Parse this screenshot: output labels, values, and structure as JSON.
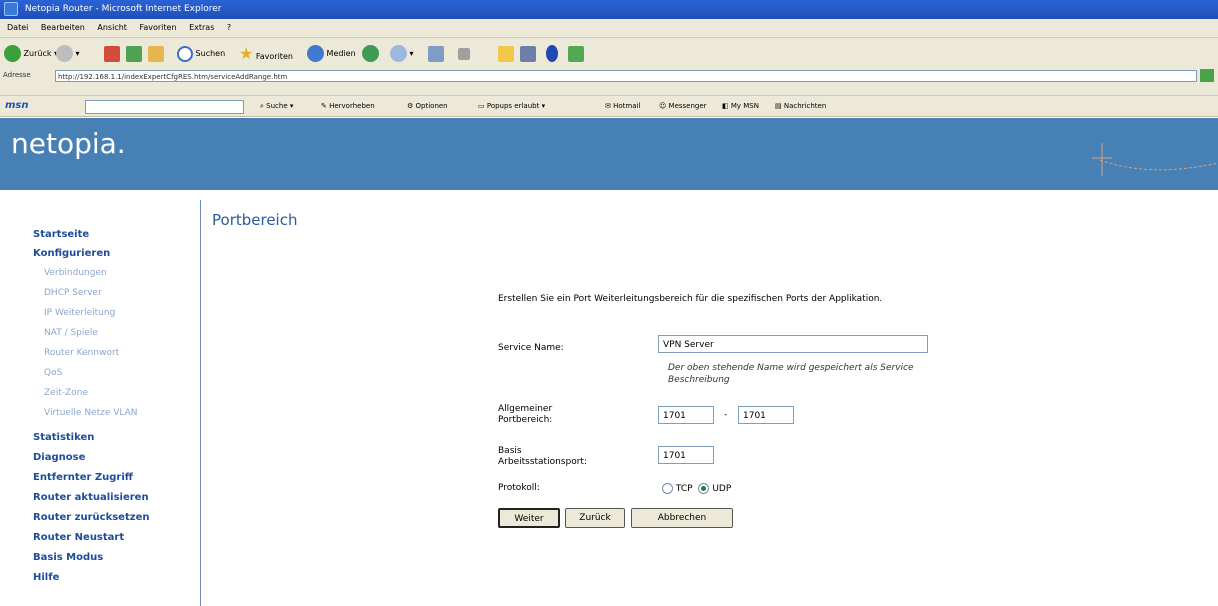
{
  "window": {
    "title": "Netopia Router - Microsoft Internet Explorer"
  },
  "menu": [
    "Datei",
    "Bearbeiten",
    "Ansicht",
    "Favoriten",
    "Extras",
    "?"
  ],
  "toolbar": {
    "back": "Zurück",
    "search": "Suchen",
    "favorites": "Favoriten",
    "media": "Medien"
  },
  "address": {
    "label": "Adresse",
    "url": "http://192.168.1.1/indexExpertCfgRES.htm/serviceAddRange.htm",
    "go": "Wechseln zu"
  },
  "msn": {
    "logo": "msn",
    "search": "Suche",
    "highlight": "Hervorheben",
    "options": "Optionen",
    "popups": "Popups erlaubt",
    "hotmail": "Hotmail",
    "messenger": "Messenger",
    "mymsn": "My MSN",
    "news": "Nachrichten"
  },
  "brand": {
    "logo": "netopia."
  },
  "sidebar": {
    "links": [
      {
        "label": "Startseite",
        "type": "main"
      },
      {
        "label": "Konfigurieren",
        "type": "main"
      },
      {
        "label": "Verbindungen",
        "type": "sub"
      },
      {
        "label": "DHCP Server",
        "type": "sub"
      },
      {
        "label": "IP Weiterleitung",
        "type": "sub"
      },
      {
        "label": "NAT / Spiele",
        "type": "sub"
      },
      {
        "label": "Router Kennwort",
        "type": "sub"
      },
      {
        "label": "QoS",
        "type": "sub"
      },
      {
        "label": "Zeit-Zone",
        "type": "sub"
      },
      {
        "label": "Virtuelle Netze VLAN",
        "type": "sub"
      },
      {
        "label": "Statistiken",
        "type": "main"
      },
      {
        "label": "Diagnose",
        "type": "main"
      },
      {
        "label": "Entfernter Zugriff",
        "type": "main"
      },
      {
        "label": "Router aktualisieren",
        "type": "main"
      },
      {
        "label": "Router zurücksetzen",
        "type": "main"
      },
      {
        "label": "Router Neustart",
        "type": "main"
      },
      {
        "label": "Basis Modus",
        "type": "main"
      },
      {
        "label": "Hilfe",
        "type": "main"
      }
    ]
  },
  "content": {
    "title": "Portbereich",
    "intro": "Erstellen Sie ein Port Weiterleitungsbereich für die spezifischen Ports der Applikation.",
    "service_name_label": "Service Name:",
    "service_name_value": "VPN Server",
    "service_note_line1": "Der oben stehende Name wird gespeichert als Service",
    "service_note_line2": "Beschreibung",
    "port_range_label_1": "Allgemeiner",
    "port_range_label_2": "Portbereich:",
    "port_start": "1701",
    "range_dash": "-",
    "port_end": "1701",
    "base_port_label_1": "Basis",
    "base_port_label_2": "Arbeitsstationsport:",
    "base_port_value": "1701",
    "protocol_label": "Protokoll:",
    "protocol_tcp": "TCP",
    "protocol_udp": "UDP",
    "protocol_selected": "UDP",
    "btn_next": "Weiter",
    "btn_back": "Zurück",
    "btn_cancel": "Abbrechen"
  }
}
